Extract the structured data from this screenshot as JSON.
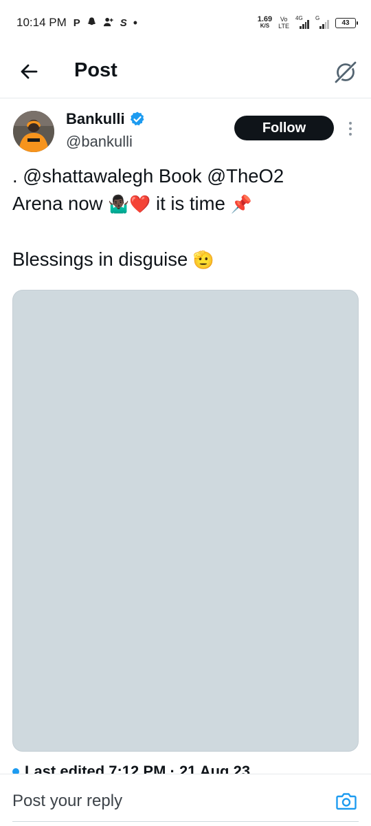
{
  "status_bar": {
    "time": "10:14 PM",
    "notification_icons": [
      "P",
      "snapchat-icon",
      "add-user-icon",
      "S",
      "•"
    ],
    "net_speed_value": "1.69",
    "net_speed_unit": "K/S",
    "volte_top": "Vo",
    "volte_bottom": "LTE",
    "sim1_label": "4G",
    "sim2_label": "G",
    "battery": "43"
  },
  "header": {
    "title": "Post"
  },
  "author": {
    "name": "Bankulli",
    "handle": "@bankulli",
    "verified": true,
    "follow_label": "Follow"
  },
  "post": {
    "line1_prefix": ". ",
    "mention1": "@shattawalegh",
    "line1_mid": " Book ",
    "mention2": "@TheO2",
    "line2_text": "Arena now ",
    "line2_emoji": "🤷🏿‍♂️❤️",
    "line2_suffix": " it is time ",
    "line2_end_emoji": "📌",
    "line3_text": "Blessings in disguise ",
    "line3_emoji": "🫡",
    "edited_text": "Last edited 7:12 PM · 21 Aug 23"
  },
  "reply": {
    "placeholder": "Post your reply"
  },
  "colors": {
    "accent": "#1d9bf0",
    "text": "#0f1419",
    "media_placeholder": "#cfd9de",
    "follow_bg": "#0f1419"
  }
}
